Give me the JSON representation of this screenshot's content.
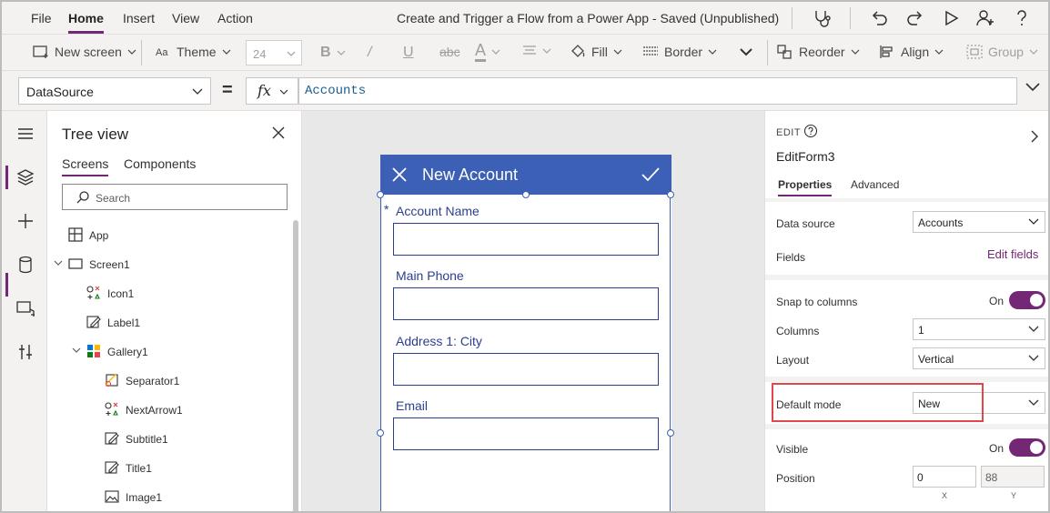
{
  "menu": {
    "items": [
      {
        "label": "File"
      },
      {
        "label": "Home"
      },
      {
        "label": "Insert"
      },
      {
        "label": "View"
      },
      {
        "label": "Action"
      }
    ],
    "active": "Home",
    "app_title": "Create and Trigger a Flow from a Power App - Saved (Unpublished)",
    "icons": [
      "stethoscope-icon",
      "undo-icon",
      "redo-icon",
      "play-icon",
      "user-add-icon",
      "help-icon"
    ]
  },
  "toolbar": {
    "new_screen": "New screen",
    "theme": "Theme",
    "font_size": "24",
    "fill": "Fill",
    "border": "Border",
    "reorder": "Reorder",
    "align": "Align",
    "group": "Group"
  },
  "formula": {
    "property": "DataSource",
    "equals": "=",
    "fx": "fx",
    "value": "Accounts"
  },
  "tree": {
    "title": "Tree view",
    "tabs": [
      {
        "label": "Screens"
      },
      {
        "label": "Components"
      }
    ],
    "search_placeholder": "Search",
    "items": [
      {
        "label": "App",
        "icon": "app-icon"
      },
      {
        "label": "Screen1",
        "icon": "screen-icon"
      },
      {
        "label": "Icon1",
        "icon": "icon-control-icon"
      },
      {
        "label": "Label1",
        "icon": "label-edit-icon"
      },
      {
        "label": "Gallery1",
        "icon": "gallery-icon"
      },
      {
        "label": "Separator1",
        "icon": "separator-icon"
      },
      {
        "label": "NextArrow1",
        "icon": "icon-control-icon"
      },
      {
        "label": "Subtitle1",
        "icon": "label-edit-icon"
      },
      {
        "label": "Title1",
        "icon": "label-edit-icon"
      },
      {
        "label": "Image1",
        "icon": "image-icon"
      }
    ]
  },
  "phone": {
    "title": "New Account",
    "fields": [
      {
        "label": "Account Name",
        "required": "*"
      },
      {
        "label": "Main Phone"
      },
      {
        "label": "Address 1: City"
      },
      {
        "label": "Email"
      }
    ]
  },
  "props": {
    "edit_label": "EDIT",
    "form_name": "EditForm3",
    "tabs": [
      {
        "label": "Properties"
      },
      {
        "label": "Advanced"
      }
    ],
    "data_source_label": "Data source",
    "data_source_value": "Accounts",
    "fields_label": "Fields",
    "edit_fields": "Edit fields",
    "snap_label": "Snap to columns",
    "snap_state": "On",
    "columns_label": "Columns",
    "columns_value": "1",
    "layout_label": "Layout",
    "layout_value": "Vertical",
    "default_mode_label": "Default mode",
    "default_mode_value": "New",
    "visible_label": "Visible",
    "visible_state": "On",
    "position_label": "Position",
    "position_x": "0",
    "position_y": "88",
    "x_label": "X",
    "y_label": "Y",
    "colors": {
      "accent": "#742774",
      "header": "#3b60b6",
      "highlight": "#e0464b"
    }
  }
}
